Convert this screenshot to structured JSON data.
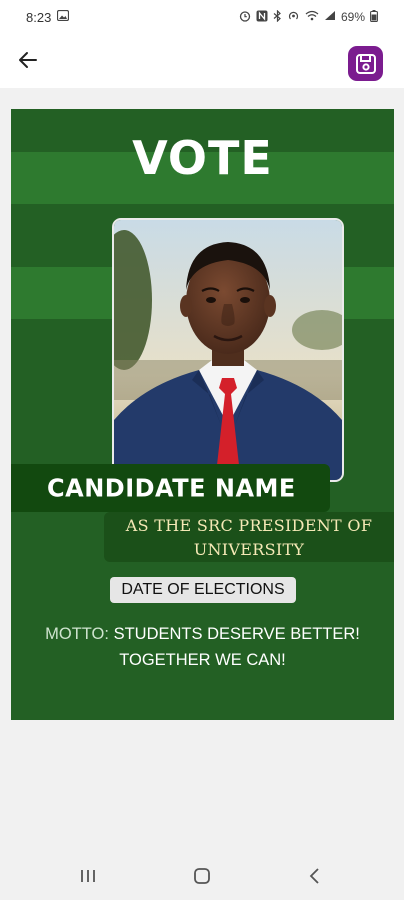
{
  "status_bar": {
    "time": "8:23",
    "battery_text": "69%"
  },
  "app_bar": {
    "back_icon": "arrow-left-icon",
    "save_icon": "save-disk-icon",
    "accent_color": "#7b1c8f"
  },
  "poster": {
    "background_color": "#236024",
    "band_color": "#2e7a2f",
    "title": "VOTE",
    "candidate_name": "CANDIDATE NAME",
    "position_line1": "AS THE SRC PRESIDENT OF",
    "position_line2": "UNIVERSITY",
    "date_label": "DATE OF ELECTIONS",
    "motto_label": "MOTTO:",
    "motto_line1": "STUDENTS DESERVE BETTER!",
    "motto_line2": "TOGETHER WE CAN!"
  },
  "nav_bar": {
    "recents_icon": "recents-icon",
    "home_icon": "home-icon",
    "back_icon": "nav-back-icon"
  }
}
